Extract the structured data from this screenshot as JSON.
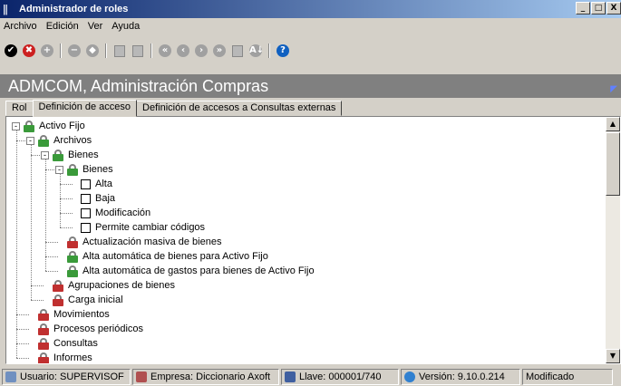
{
  "window": {
    "title": "Administrador de roles",
    "controls": [
      "_",
      "□",
      "X"
    ]
  },
  "menu": [
    "Archivo",
    "Edición",
    "Ver",
    "Ayuda"
  ],
  "toolbar": {
    "buttons": [
      {
        "name": "confirm-icon",
        "glyph": "✔",
        "color": "#000000"
      },
      {
        "name": "cancel-icon",
        "glyph": "✖",
        "color": "#cc2020"
      },
      {
        "name": "add-icon",
        "glyph": "+",
        "color": "#a0a0a0"
      },
      {
        "name": "remove-icon",
        "glyph": "−",
        "color": "#a0a0a0"
      },
      {
        "name": "clear-icon",
        "glyph": "◆",
        "color": "#a0a0a0"
      },
      {
        "name": "document-icon",
        "glyph": "",
        "color": "#a0a0a0"
      },
      {
        "name": "print-icon",
        "glyph": "",
        "color": "#a0a0a0"
      },
      {
        "name": "first-icon",
        "glyph": "«",
        "color": "#a0a0a0"
      },
      {
        "name": "previous-icon",
        "glyph": "‹",
        "color": "#a0a0a0"
      },
      {
        "name": "next-icon",
        "glyph": "›",
        "color": "#a0a0a0"
      },
      {
        "name": "last-icon",
        "glyph": "»",
        "color": "#a0a0a0"
      },
      {
        "name": "grid-icon",
        "glyph": "",
        "color": "#a0a0a0"
      },
      {
        "name": "sort-icon",
        "glyph": "A↓",
        "color": "#a0a0a0"
      },
      {
        "name": "help-icon",
        "glyph": "?",
        "color": "#1060c0"
      }
    ]
  },
  "banner": {
    "title": "ADMCOM, Administración Compras"
  },
  "tabs": [
    {
      "label": "Rol",
      "active": false
    },
    {
      "label": "Definición de acceso",
      "active": true
    },
    {
      "label": "Definición de accesos a Consultas externas",
      "active": false
    }
  ],
  "tree": [
    {
      "label": "Activo Fijo",
      "level": 0,
      "exp": "-",
      "icon": "green"
    },
    {
      "label": "Archivos",
      "level": 1,
      "exp": "-",
      "icon": "green"
    },
    {
      "label": "Bienes",
      "level": 2,
      "exp": "-",
      "icon": "green"
    },
    {
      "label": "Bienes",
      "level": 3,
      "exp": "-",
      "icon": "green"
    },
    {
      "label": "Alta",
      "level": 4,
      "exp": "",
      "icon": "check"
    },
    {
      "label": "Baja",
      "level": 4,
      "exp": "",
      "icon": "check"
    },
    {
      "label": "Modificación",
      "level": 4,
      "exp": "",
      "icon": "check"
    },
    {
      "label": "Permite cambiar códigos",
      "level": 4,
      "exp": "",
      "icon": "check"
    },
    {
      "label": "Actualización masiva de bienes",
      "level": 3,
      "exp": "",
      "icon": "red"
    },
    {
      "label": "Alta automática de bienes para Activo Fijo",
      "level": 3,
      "exp": "",
      "icon": "green"
    },
    {
      "label": "Alta automática de gastos para bienes de Activo Fijo",
      "level": 3,
      "exp": "",
      "icon": "green"
    },
    {
      "label": "Agrupaciones de bienes",
      "level": 2,
      "exp": "",
      "icon": "red"
    },
    {
      "label": "Carga inicial",
      "level": 2,
      "exp": "",
      "icon": "red"
    },
    {
      "label": "Movimientos",
      "level": 1,
      "exp": "",
      "icon": "red"
    },
    {
      "label": "Procesos periódicos",
      "level": 1,
      "exp": "",
      "icon": "red"
    },
    {
      "label": "Consultas",
      "level": 1,
      "exp": "",
      "icon": "red"
    },
    {
      "label": "Informes",
      "level": 1,
      "exp": "",
      "icon": "red"
    }
  ],
  "status": {
    "user": "Usuario: SUPERVISOF",
    "company": "Empresa: Diccionario Axoft",
    "key": "Llave: 000001/740",
    "version": "Versión: 9.10.0.214",
    "state": "Modificado"
  }
}
